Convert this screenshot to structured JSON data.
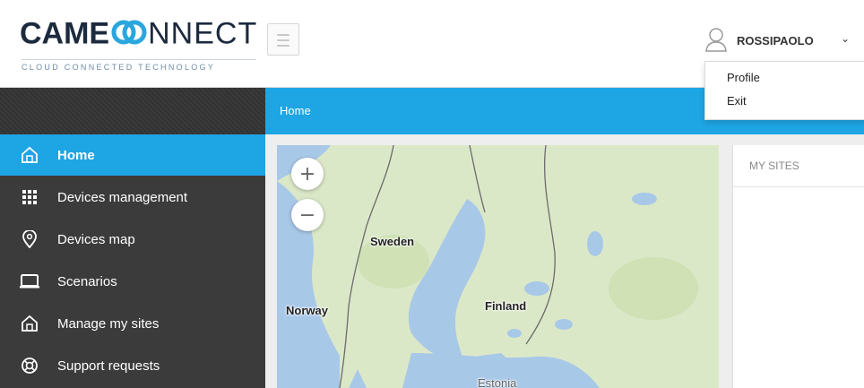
{
  "header": {
    "brand_bold": "CAME",
    "brand_light": "NNECT",
    "tagline": "CLOUD CONNECTED TECHNOLOGY",
    "username": "ROSSIPAOLO",
    "caret": "⌄"
  },
  "user_menu": {
    "items": [
      {
        "label": "Profile"
      },
      {
        "label": "Exit"
      }
    ]
  },
  "breadcrumb": {
    "current": "Home"
  },
  "sidebar": {
    "items": [
      {
        "label": "Home",
        "icon": "home-icon",
        "active": true
      },
      {
        "label": "Devices management",
        "icon": "grid-icon",
        "active": false
      },
      {
        "label": "Devices map",
        "icon": "map-pin-icon",
        "active": false
      },
      {
        "label": "Scenarios",
        "icon": "monitor-icon",
        "active": false
      },
      {
        "label": "Manage my sites",
        "icon": "house-icon",
        "active": false
      },
      {
        "label": "Support requests",
        "icon": "lifebuoy-icon",
        "active": false
      }
    ]
  },
  "map": {
    "zoom_in": "+",
    "zoom_out": "−",
    "labels": {
      "sweden": "Sweden",
      "norway": "Norway",
      "finland": "Finland",
      "estonia": "Estonia"
    }
  },
  "panel": {
    "title": "MY SITES"
  },
  "colors": {
    "accent": "#1ea5e3",
    "sidebar": "#3b3b3b",
    "brand": "#1c2a3e",
    "logo_ring": "#2aa6df"
  }
}
